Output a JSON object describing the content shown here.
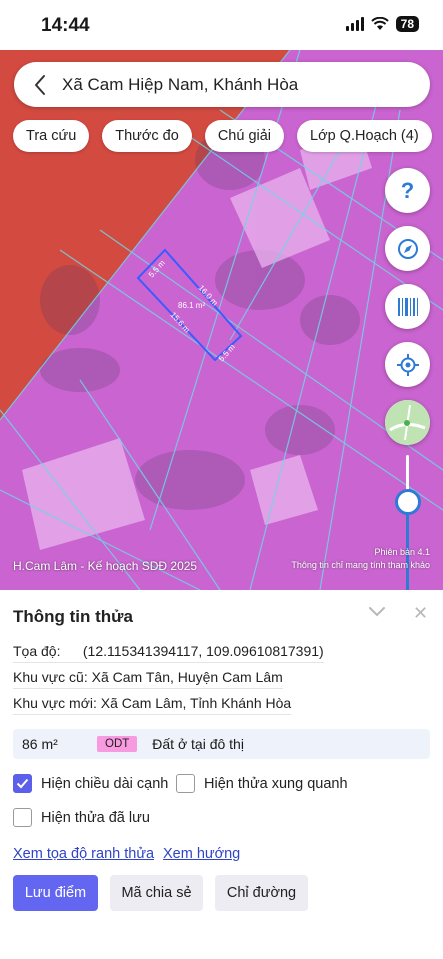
{
  "status_bar": {
    "time": "14:44",
    "battery": "78"
  },
  "search": {
    "location": "Xã Cam Hiệp Nam, Khánh Hòa"
  },
  "chips": [
    "Tra cứu",
    "Thước đo",
    "Chú giải",
    "Lớp Q.Hoạch (4)"
  ],
  "map": {
    "caption": "H.Cam Lâm - Kế hoạch SDĐ 2025",
    "version": "Phiên bản 4.1",
    "disclaimer": "Thông tin chỉ mang tính tham khảo",
    "parcel": {
      "side_top": "5.5 m",
      "side_right": "16.0 m",
      "side_left": "15.6 m",
      "side_bottom": "5.5 m",
      "area": "86.1 m²"
    },
    "fabs": [
      "help-icon",
      "compass-icon",
      "barcode-icon",
      "locate-icon",
      "map-layer-icon"
    ],
    "colors": {
      "plan_pink": "#d05ee0",
      "plan_red": "#e0403c",
      "accent": "#2e7bd6"
    }
  },
  "panel": {
    "title": "Thông tin thửa",
    "coord_label": "Tọa độ:",
    "coord_value": "(12.115341394117, 109.09610817391)",
    "old_area_label": "Khu vực cũ:",
    "old_area_value": "Xã Cam Tân, Huyện Cam Lâm",
    "new_area_label": "Khu vực mới:",
    "new_area_value": "Xã Cam Lâm, Tỉnh Khánh Hòa",
    "area": "86 m²",
    "land_code": "ODT",
    "land_type": "Đất ở tại đô thị",
    "checkboxes": [
      {
        "label": "Hiện chiều dài cạnh",
        "checked": true
      },
      {
        "label": "Hiện thửa xung quanh",
        "checked": false
      },
      {
        "label": "Hiện thửa đã lưu",
        "checked": false
      }
    ],
    "links": [
      "Xem tọa độ ranh thửa",
      "Xem hướng"
    ],
    "buttons": [
      "Lưu điểm",
      "Mã chia sẻ",
      "Chỉ đường"
    ]
  }
}
